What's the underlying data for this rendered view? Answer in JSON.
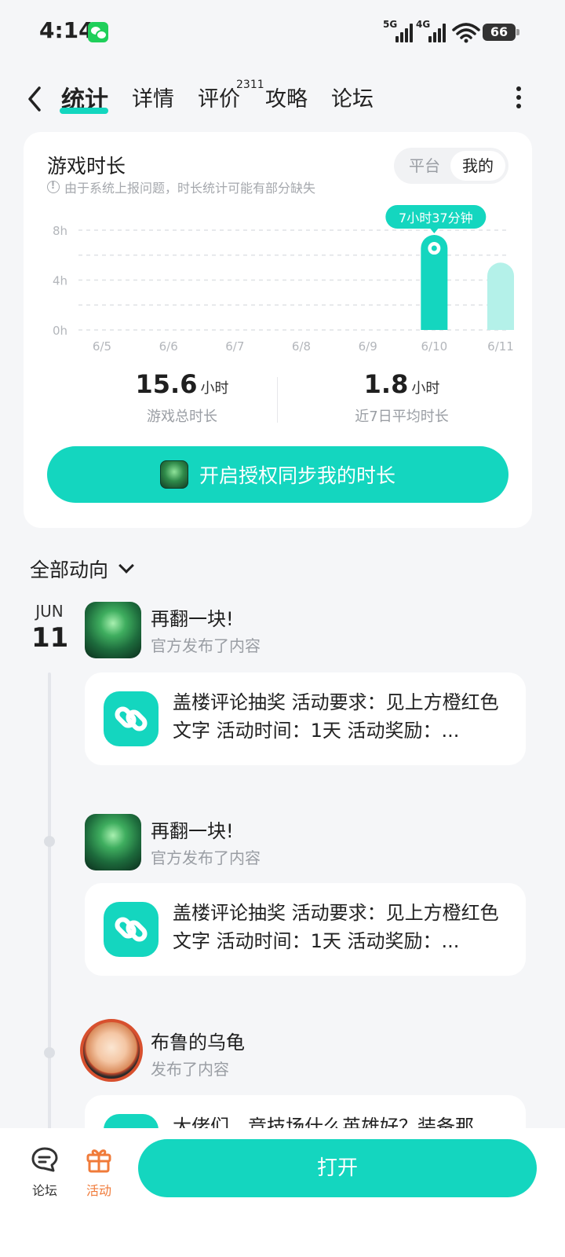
{
  "status": {
    "time": "4:14",
    "signal1": "5G",
    "signal2": "4G",
    "battery": "66"
  },
  "nav": {
    "tabs": [
      {
        "label": "统计"
      },
      {
        "label": "详情"
      },
      {
        "label": "评价"
      },
      {
        "label": "攻略"
      },
      {
        "label": "论坛"
      }
    ],
    "review_count": "2311"
  },
  "stats": {
    "title": "游戏时长",
    "note": "由于系统上报问题，时长统计可能有部分缺失",
    "toggle": {
      "platform": "平台",
      "mine": "我的"
    },
    "total": {
      "value": "15.6",
      "unit": "小时",
      "label": "游戏总时长"
    },
    "avg": {
      "value": "1.8",
      "unit": "小时",
      "label": "近7日平均时长"
    },
    "sync_button": "开启授权同步我的时长"
  },
  "chart_data": {
    "type": "bar",
    "categories": [
      "6/5",
      "6/6",
      "6/7",
      "6/8",
      "6/9",
      "6/10",
      "6/11"
    ],
    "values": [
      0,
      0,
      0,
      0,
      0,
      7.62,
      5.4
    ],
    "yticks": [
      "0h",
      "4h",
      "8h"
    ],
    "ylim": [
      0,
      8
    ],
    "highlight_index": 5,
    "tooltip": "7小时37分钟",
    "colors": {
      "bar": "#14d6bf",
      "bar_light": "#b4f1e9",
      "grid": "#dfe2e6"
    },
    "grid": true
  },
  "feed": {
    "filter_label": "全部动向",
    "date": {
      "month": "JUN",
      "day": "11"
    },
    "posts": [
      {
        "name": "再翻一块!",
        "sub": "官方发布了内容",
        "text": "盖楼评论抽奖 活动要求：见上方橙红色文字 活动时间：1天 活动奖励：..."
      },
      {
        "name": "再翻一块!",
        "sub": "官方发布了内容",
        "text": "盖楼评论抽奖 活动要求：见上方橙红色文字 活动时间：1天 活动奖励：..."
      },
      {
        "name": "布鲁的乌龟",
        "sub": "发布了内容",
        "text": "大佬们，竞技场什么英雄好？装备那"
      }
    ]
  },
  "bottom": {
    "forum": "论坛",
    "activity": "活动",
    "open": "打开"
  },
  "colors": {
    "accent": "#14d6bf",
    "activity": "#f07b3a"
  }
}
